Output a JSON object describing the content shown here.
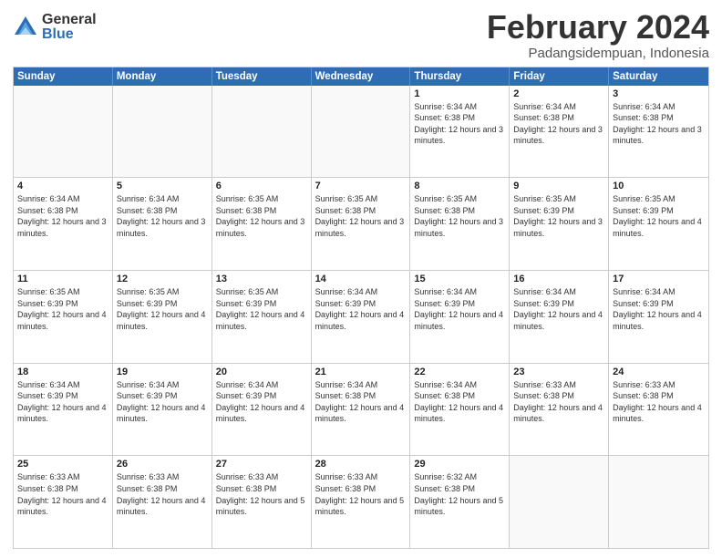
{
  "header": {
    "logo": {
      "general": "General",
      "blue": "Blue"
    },
    "title": "February 2024",
    "location": "Padangsidempuan, Indonesia"
  },
  "calendar": {
    "days": [
      "Sunday",
      "Monday",
      "Tuesday",
      "Wednesday",
      "Thursday",
      "Friday",
      "Saturday"
    ],
    "rows": [
      [
        {
          "day": "",
          "info": ""
        },
        {
          "day": "",
          "info": ""
        },
        {
          "day": "",
          "info": ""
        },
        {
          "day": "",
          "info": ""
        },
        {
          "day": "1",
          "info": "Sunrise: 6:34 AM\nSunset: 6:38 PM\nDaylight: 12 hours and 3 minutes."
        },
        {
          "day": "2",
          "info": "Sunrise: 6:34 AM\nSunset: 6:38 PM\nDaylight: 12 hours and 3 minutes."
        },
        {
          "day": "3",
          "info": "Sunrise: 6:34 AM\nSunset: 6:38 PM\nDaylight: 12 hours and 3 minutes."
        }
      ],
      [
        {
          "day": "4",
          "info": "Sunrise: 6:34 AM\nSunset: 6:38 PM\nDaylight: 12 hours and 3 minutes."
        },
        {
          "day": "5",
          "info": "Sunrise: 6:34 AM\nSunset: 6:38 PM\nDaylight: 12 hours and 3 minutes."
        },
        {
          "day": "6",
          "info": "Sunrise: 6:35 AM\nSunset: 6:38 PM\nDaylight: 12 hours and 3 minutes."
        },
        {
          "day": "7",
          "info": "Sunrise: 6:35 AM\nSunset: 6:38 PM\nDaylight: 12 hours and 3 minutes."
        },
        {
          "day": "8",
          "info": "Sunrise: 6:35 AM\nSunset: 6:38 PM\nDaylight: 12 hours and 3 minutes."
        },
        {
          "day": "9",
          "info": "Sunrise: 6:35 AM\nSunset: 6:39 PM\nDaylight: 12 hours and 3 minutes."
        },
        {
          "day": "10",
          "info": "Sunrise: 6:35 AM\nSunset: 6:39 PM\nDaylight: 12 hours and 4 minutes."
        }
      ],
      [
        {
          "day": "11",
          "info": "Sunrise: 6:35 AM\nSunset: 6:39 PM\nDaylight: 12 hours and 4 minutes."
        },
        {
          "day": "12",
          "info": "Sunrise: 6:35 AM\nSunset: 6:39 PM\nDaylight: 12 hours and 4 minutes."
        },
        {
          "day": "13",
          "info": "Sunrise: 6:35 AM\nSunset: 6:39 PM\nDaylight: 12 hours and 4 minutes."
        },
        {
          "day": "14",
          "info": "Sunrise: 6:34 AM\nSunset: 6:39 PM\nDaylight: 12 hours and 4 minutes."
        },
        {
          "day": "15",
          "info": "Sunrise: 6:34 AM\nSunset: 6:39 PM\nDaylight: 12 hours and 4 minutes."
        },
        {
          "day": "16",
          "info": "Sunrise: 6:34 AM\nSunset: 6:39 PM\nDaylight: 12 hours and 4 minutes."
        },
        {
          "day": "17",
          "info": "Sunrise: 6:34 AM\nSunset: 6:39 PM\nDaylight: 12 hours and 4 minutes."
        }
      ],
      [
        {
          "day": "18",
          "info": "Sunrise: 6:34 AM\nSunset: 6:39 PM\nDaylight: 12 hours and 4 minutes."
        },
        {
          "day": "19",
          "info": "Sunrise: 6:34 AM\nSunset: 6:39 PM\nDaylight: 12 hours and 4 minutes."
        },
        {
          "day": "20",
          "info": "Sunrise: 6:34 AM\nSunset: 6:39 PM\nDaylight: 12 hours and 4 minutes."
        },
        {
          "day": "21",
          "info": "Sunrise: 6:34 AM\nSunset: 6:38 PM\nDaylight: 12 hours and 4 minutes."
        },
        {
          "day": "22",
          "info": "Sunrise: 6:34 AM\nSunset: 6:38 PM\nDaylight: 12 hours and 4 minutes."
        },
        {
          "day": "23",
          "info": "Sunrise: 6:33 AM\nSunset: 6:38 PM\nDaylight: 12 hours and 4 minutes."
        },
        {
          "day": "24",
          "info": "Sunrise: 6:33 AM\nSunset: 6:38 PM\nDaylight: 12 hours and 4 minutes."
        }
      ],
      [
        {
          "day": "25",
          "info": "Sunrise: 6:33 AM\nSunset: 6:38 PM\nDaylight: 12 hours and 4 minutes."
        },
        {
          "day": "26",
          "info": "Sunrise: 6:33 AM\nSunset: 6:38 PM\nDaylight: 12 hours and 4 minutes."
        },
        {
          "day": "27",
          "info": "Sunrise: 6:33 AM\nSunset: 6:38 PM\nDaylight: 12 hours and 5 minutes."
        },
        {
          "day": "28",
          "info": "Sunrise: 6:33 AM\nSunset: 6:38 PM\nDaylight: 12 hours and 5 minutes."
        },
        {
          "day": "29",
          "info": "Sunrise: 6:32 AM\nSunset: 6:38 PM\nDaylight: 12 hours and 5 minutes."
        },
        {
          "day": "",
          "info": ""
        },
        {
          "day": "",
          "info": ""
        }
      ]
    ]
  }
}
